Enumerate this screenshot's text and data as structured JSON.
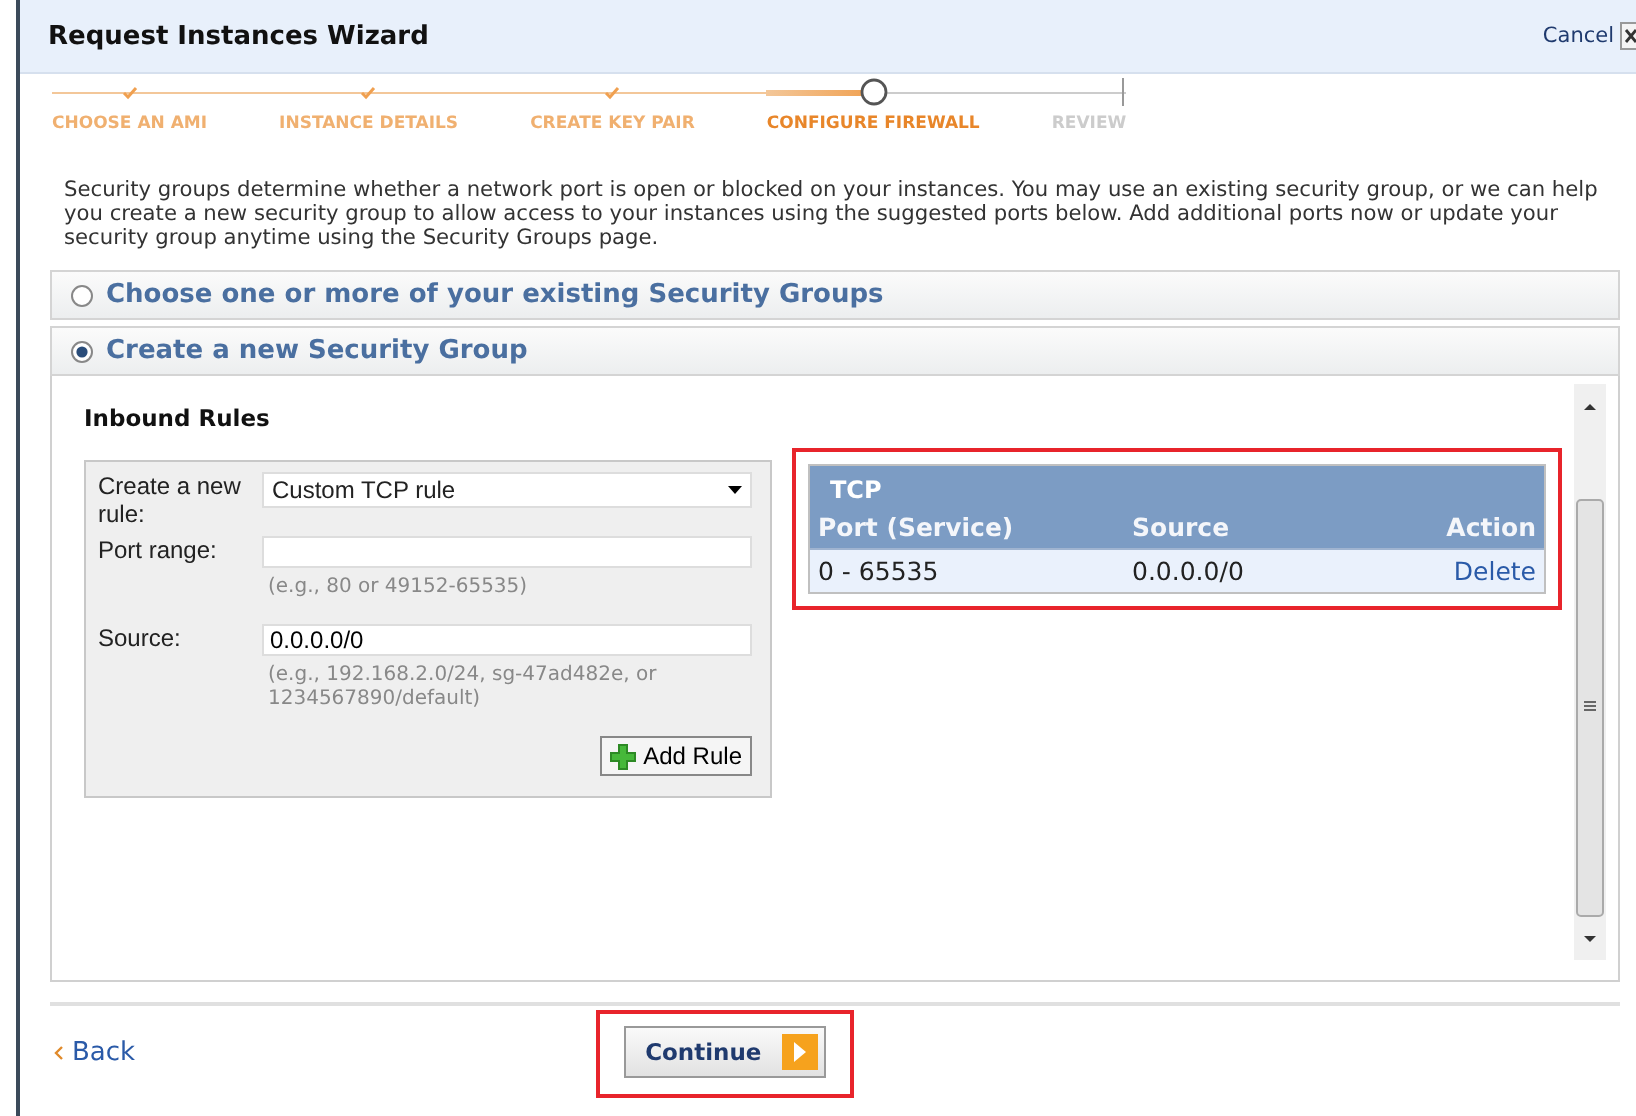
{
  "window": {
    "title": "Request Instances Wizard",
    "cancel": "Cancel"
  },
  "steps": [
    {
      "label": "CHOOSE AN AMI",
      "done": true,
      "current": false
    },
    {
      "label": "INSTANCE DETAILS",
      "done": true,
      "current": false
    },
    {
      "label": "CREATE KEY PAIR",
      "done": true,
      "current": false
    },
    {
      "label": "CONFIGURE FIREWALL",
      "done": false,
      "current": true
    },
    {
      "label": "REVIEW",
      "done": false,
      "current": false
    }
  ],
  "description": "Security groups determine whether a network port is open or blocked on your instances. You may use an existing security group, or we can help you create a new security group to allow access to your instances using the suggested ports below. Add additional ports now or update your security group anytime using the Security Groups page.",
  "options": [
    {
      "label": "Choose one or more of your existing Security Groups",
      "selected": false
    },
    {
      "label": "Create a new Security Group",
      "selected": true
    }
  ],
  "inbound": {
    "title": "Inbound Rules",
    "form": {
      "rule_label": "Create a new rule:",
      "rule_value": "Custom TCP rule",
      "port_label": "Port range:",
      "port_hint": "(e.g., 80 or 49152-65535)",
      "source_label": "Source:",
      "source_value": "0.0.0.0/0",
      "source_hint": "(e.g., 192.168.2.0/24, sg-47ad482e, or 1234567890/default)",
      "add_button": "Add Rule"
    },
    "rules": {
      "highlighted": true,
      "protocol": "TCP",
      "columns": [
        "Port (Service)",
        "Source",
        "Action"
      ],
      "rows": [
        {
          "port": "0 - 65535",
          "source": "0.0.0.0/0",
          "action": "Delete"
        }
      ]
    }
  },
  "footer": {
    "back": "Back",
    "continue": "Continue",
    "continue_highlighted": true
  }
}
